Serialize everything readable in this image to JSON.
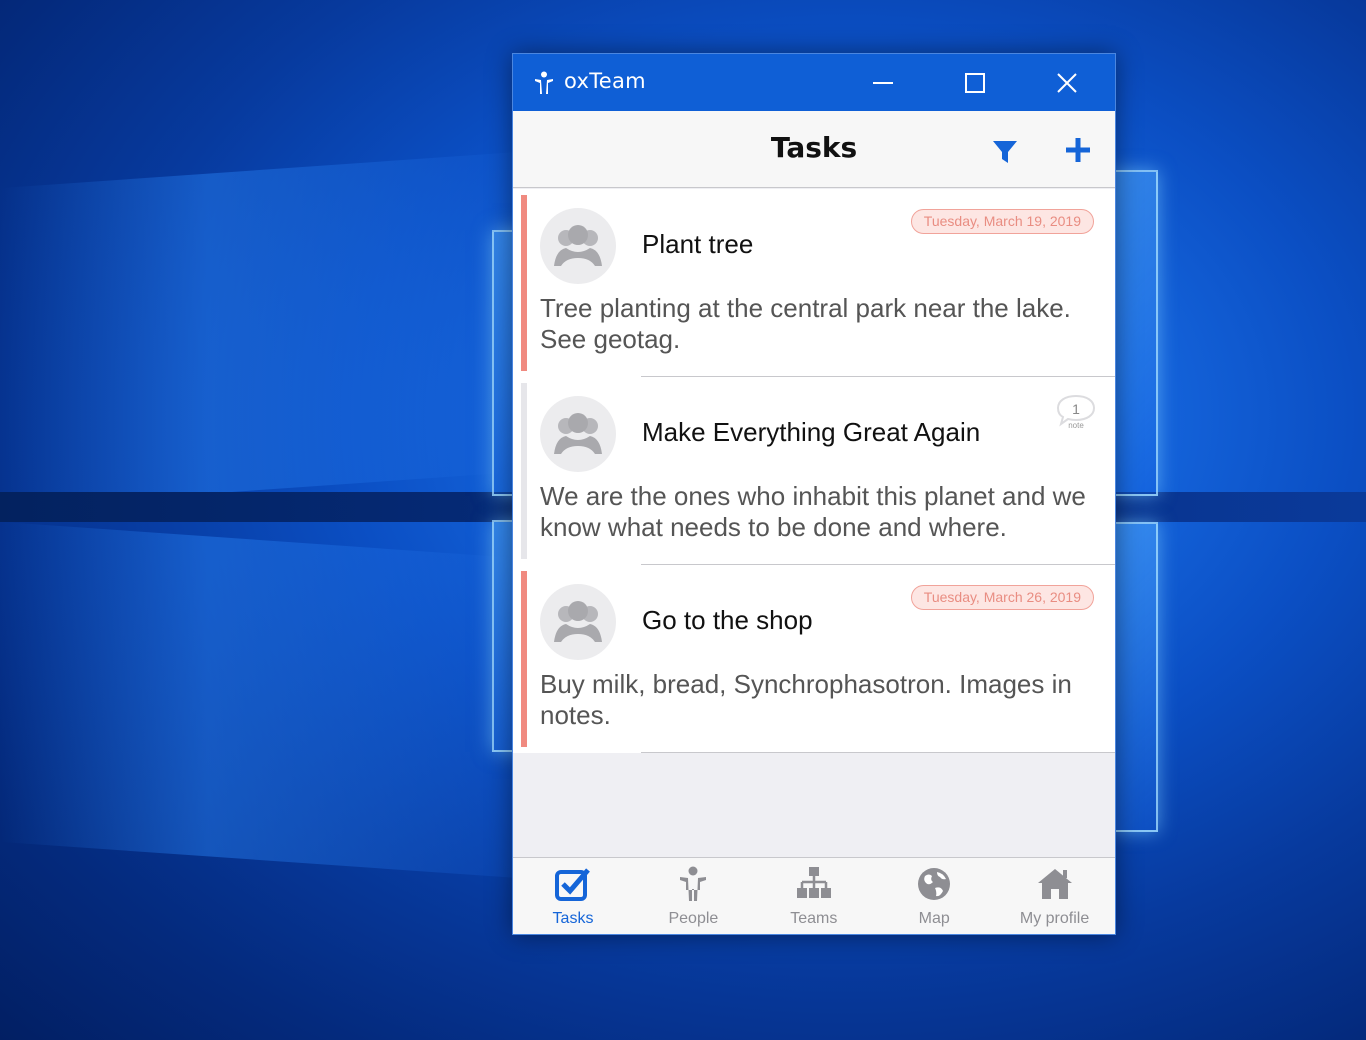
{
  "window": {
    "title": "oxTeam",
    "controls": [
      "minimize",
      "maximize",
      "close"
    ]
  },
  "navbar": {
    "title": "Tasks",
    "actions": [
      {
        "name": "filter",
        "icon": "filter-icon",
        "color": "#1565d8"
      },
      {
        "name": "add",
        "icon": "plus-icon",
        "color": "#1565d8"
      }
    ]
  },
  "tasks": [
    {
      "title": "Plant tree",
      "description": "Tree planting at the central park near the lake. See geotag.",
      "date": "Tuesday, March 19, 2019",
      "accent": "#f08a80",
      "notes": null
    },
    {
      "title": "Make Everything Great Again",
      "description": "We are the ones who inhabit this planet and we know what needs to be done and where.",
      "date": null,
      "accent": "#e6e6ea",
      "notes": {
        "count": "1",
        "label": "note"
      }
    },
    {
      "title": "Go to the shop",
      "description": "Buy milk, bread, Synchrophasotron. Images in notes.",
      "date": "Tuesday, March 26, 2019",
      "accent": "#f08a80",
      "notes": null
    }
  ],
  "tabs": [
    {
      "label": "Tasks",
      "icon": "checkbox-icon",
      "active": true
    },
    {
      "label": "People",
      "icon": "person-icon",
      "active": false
    },
    {
      "label": "Teams",
      "icon": "hierarchy-icon",
      "active": false
    },
    {
      "label": "Map",
      "icon": "globe-icon",
      "active": false
    },
    {
      "label": "My profile",
      "icon": "home-icon",
      "active": false
    }
  ],
  "colors": {
    "titlebar": "#0f5fd6",
    "accent_blue": "#1565d8",
    "inactive_tab": "#8e8e93",
    "date_badge_text": "#e98d82"
  }
}
